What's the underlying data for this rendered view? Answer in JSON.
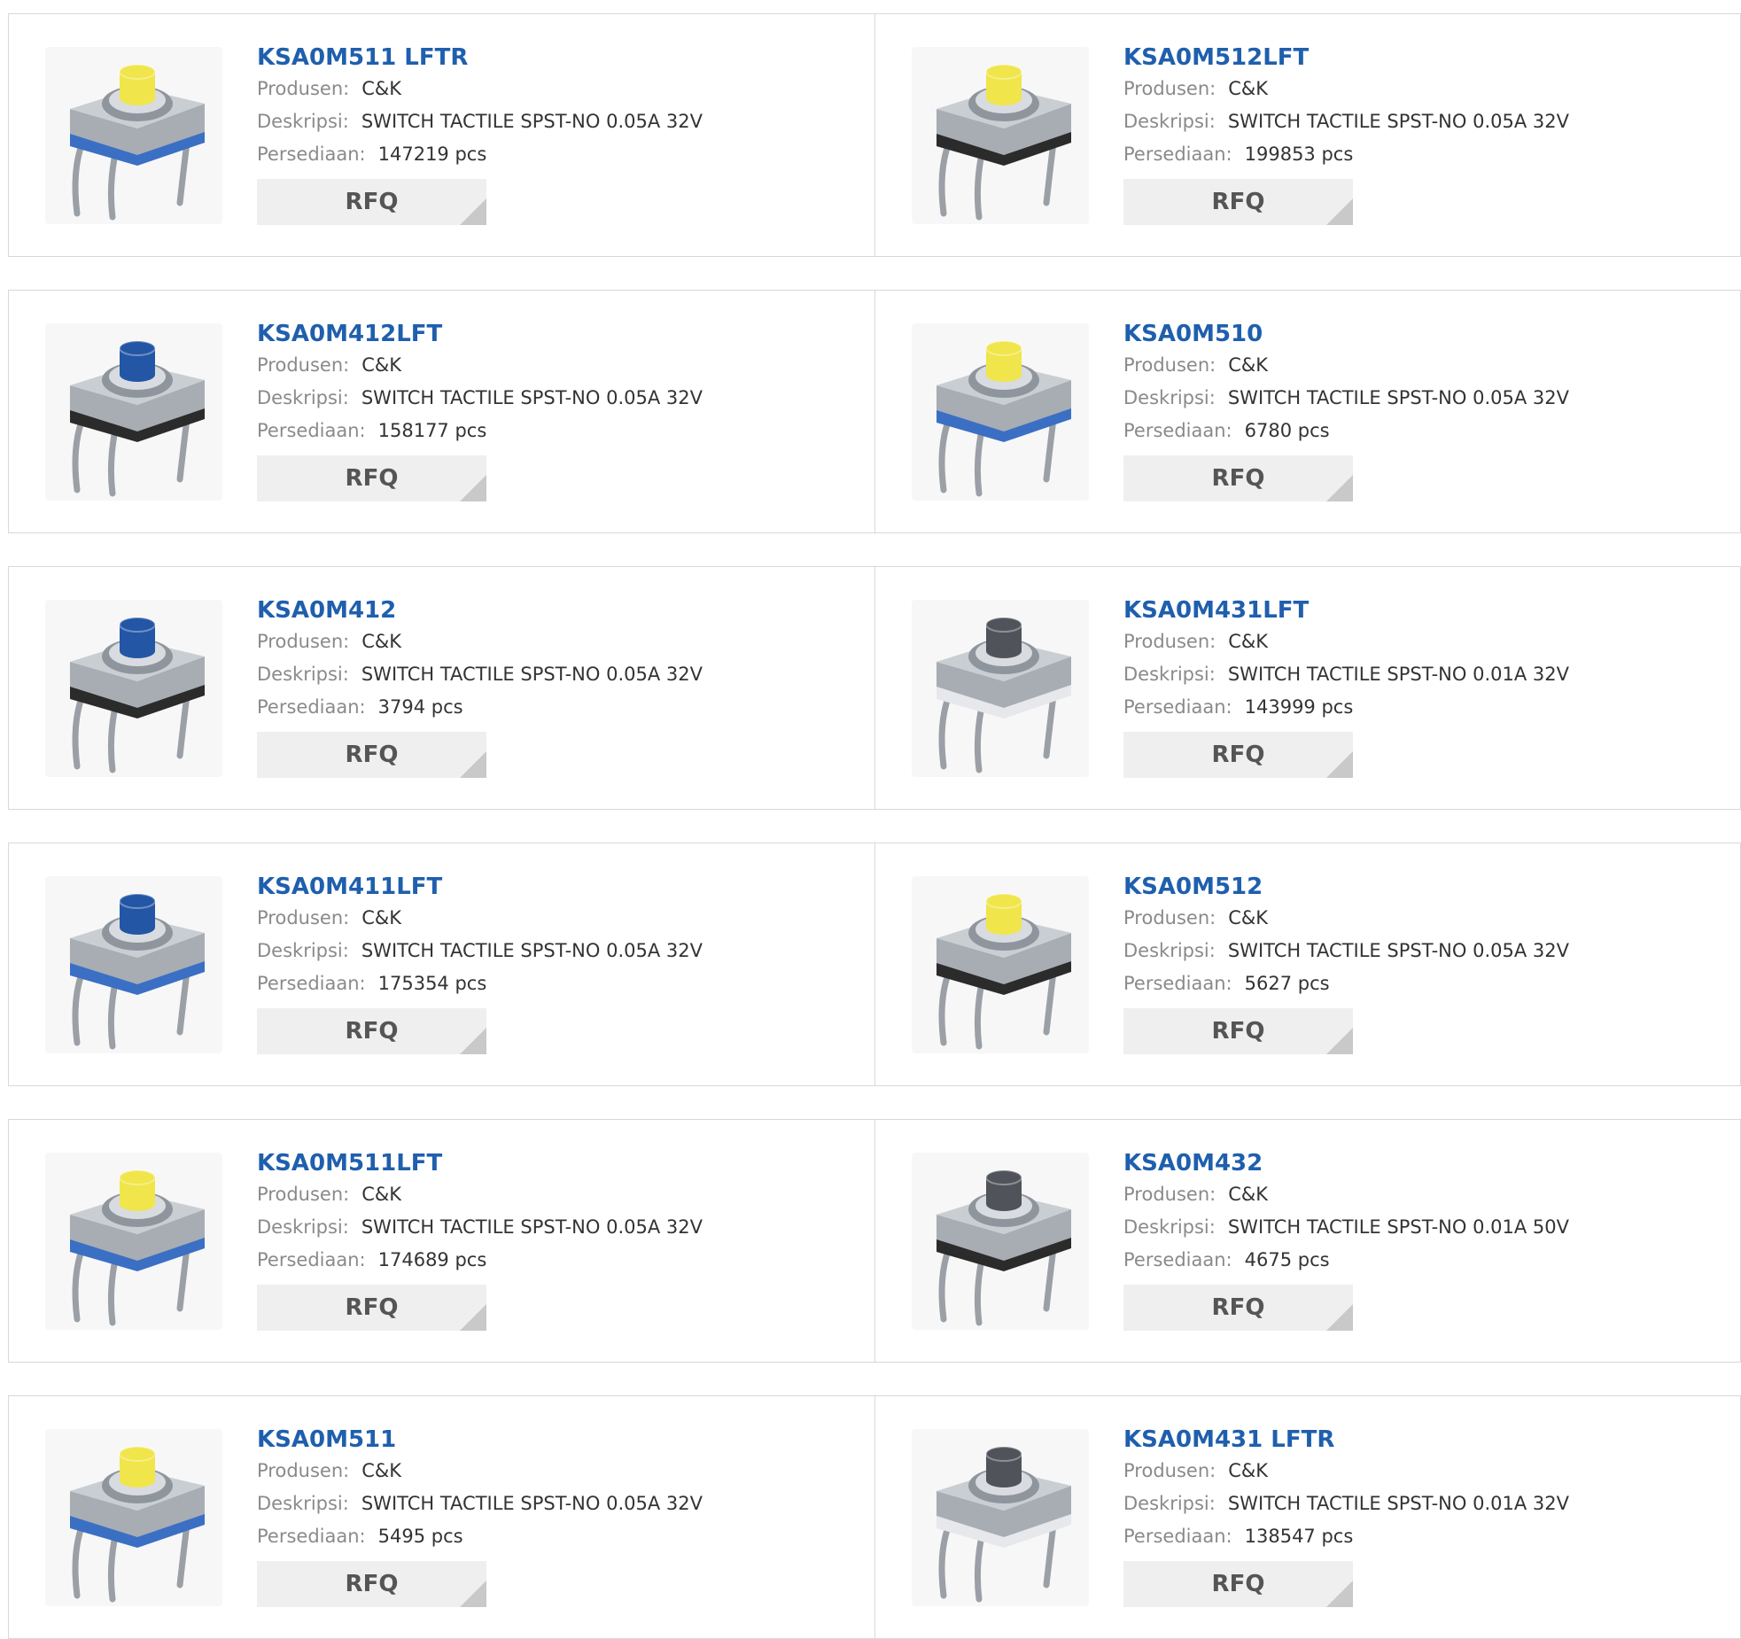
{
  "labels": {
    "manufacturer": "Produsen:",
    "description": "Deskripsi:",
    "stock": "Persediaan:",
    "rfq": "RFQ"
  },
  "colors": {
    "link": "#1f5fad",
    "label": "#8a8a8a",
    "border": "#d8d8d8",
    "button_bg": "#efefef",
    "cap_yellow": "#f0e54a",
    "cap_blue": "#2456a6",
    "cap_dark": "#50545a",
    "base_blue": "#3a6fc4",
    "base_black": "#2b2b2b",
    "base_clear": "#e6e8ec"
  },
  "products": [
    {
      "part": "KSA0M511 LFTR",
      "manufacturer": "C&K",
      "description": "SWITCH TACTILE SPST-NO 0.05A 32V",
      "stock": "147219 pcs",
      "image": "tactile-switch-yellow-cap-blue-base"
    },
    {
      "part": "KSA0M512LFT",
      "manufacturer": "C&K",
      "description": "SWITCH TACTILE SPST-NO 0.05A 32V",
      "stock": "199853 pcs",
      "image": "tactile-switch-yellow-cap-black-base"
    },
    {
      "part": "KSA0M412LFT",
      "manufacturer": "C&K",
      "description": "SWITCH TACTILE SPST-NO 0.05A 32V",
      "stock": "158177 pcs",
      "image": "tactile-switch-blue-cap-black-base"
    },
    {
      "part": "KSA0M510",
      "manufacturer": "C&K",
      "description": "SWITCH TACTILE SPST-NO 0.05A 32V",
      "stock": "6780 pcs",
      "image": "tactile-switch-yellow-cap-blue-base"
    },
    {
      "part": "KSA0M412",
      "manufacturer": "C&K",
      "description": "SWITCH TACTILE SPST-NO 0.05A 32V",
      "stock": "3794 pcs",
      "image": "tactile-switch-blue-cap-black-base"
    },
    {
      "part": "KSA0M431LFT",
      "manufacturer": "C&K",
      "description": "SWITCH TACTILE SPST-NO 0.01A 32V",
      "stock": "143999 pcs",
      "image": "tactile-switch-dark-cap-clear-base"
    },
    {
      "part": "KSA0M411LFT",
      "manufacturer": "C&K",
      "description": "SWITCH TACTILE SPST-NO 0.05A 32V",
      "stock": "175354 pcs",
      "image": "tactile-switch-blue-cap-blue-base"
    },
    {
      "part": "KSA0M512",
      "manufacturer": "C&K",
      "description": "SWITCH TACTILE SPST-NO 0.05A 32V",
      "stock": "5627 pcs",
      "image": "tactile-switch-yellow-cap-black-base"
    },
    {
      "part": "KSA0M511LFT",
      "manufacturer": "C&K",
      "description": "SWITCH TACTILE SPST-NO 0.05A 32V",
      "stock": "174689 pcs",
      "image": "tactile-switch-yellow-cap-blue-base"
    },
    {
      "part": "KSA0M432",
      "manufacturer": "C&K",
      "description": "SWITCH TACTILE SPST-NO 0.01A 50V",
      "stock": "4675 pcs",
      "image": "tactile-switch-dark-cap-black-base"
    },
    {
      "part": "KSA0M511",
      "manufacturer": "C&K",
      "description": "SWITCH TACTILE SPST-NO 0.05A 32V",
      "stock": "5495 pcs",
      "image": "tactile-switch-yellow-cap-blue-base"
    },
    {
      "part": "KSA0M431 LFTR",
      "manufacturer": "C&K",
      "description": "SWITCH TACTILE SPST-NO 0.01A 32V",
      "stock": "138547 pcs",
      "image": "tactile-switch-dark-cap-clear-base"
    }
  ]
}
